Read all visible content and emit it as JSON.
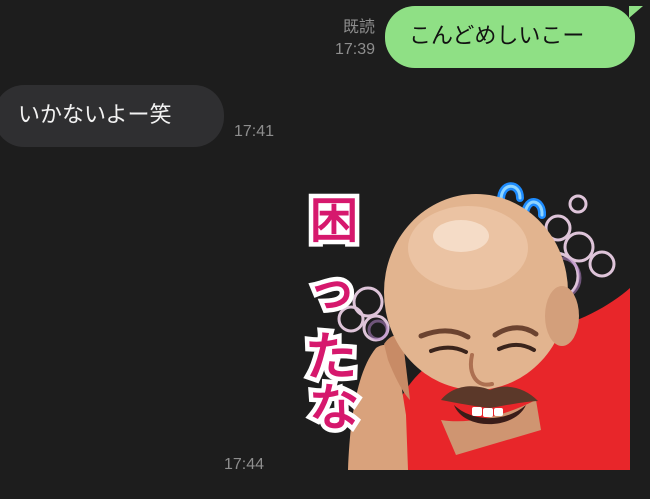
{
  "messages": [
    {
      "direction": "out",
      "text": "こんどめしいこー",
      "read_label": "既読",
      "time": "17:39"
    },
    {
      "direction": "in",
      "text": "いかないよー笑",
      "time": "17:41"
    },
    {
      "direction": "in",
      "type": "sticker",
      "sticker_text": "困ったな",
      "sticker_icon": "bald-man-sticker",
      "time": "17:44"
    }
  ],
  "colors": {
    "background": "#1d1d1d",
    "bubble_out": "#8fe085",
    "bubble_in": "#2f2f31",
    "meta_text": "#8e8e8e",
    "sticker_shirt": "#e8262a",
    "sticker_text": "#d6186d"
  }
}
